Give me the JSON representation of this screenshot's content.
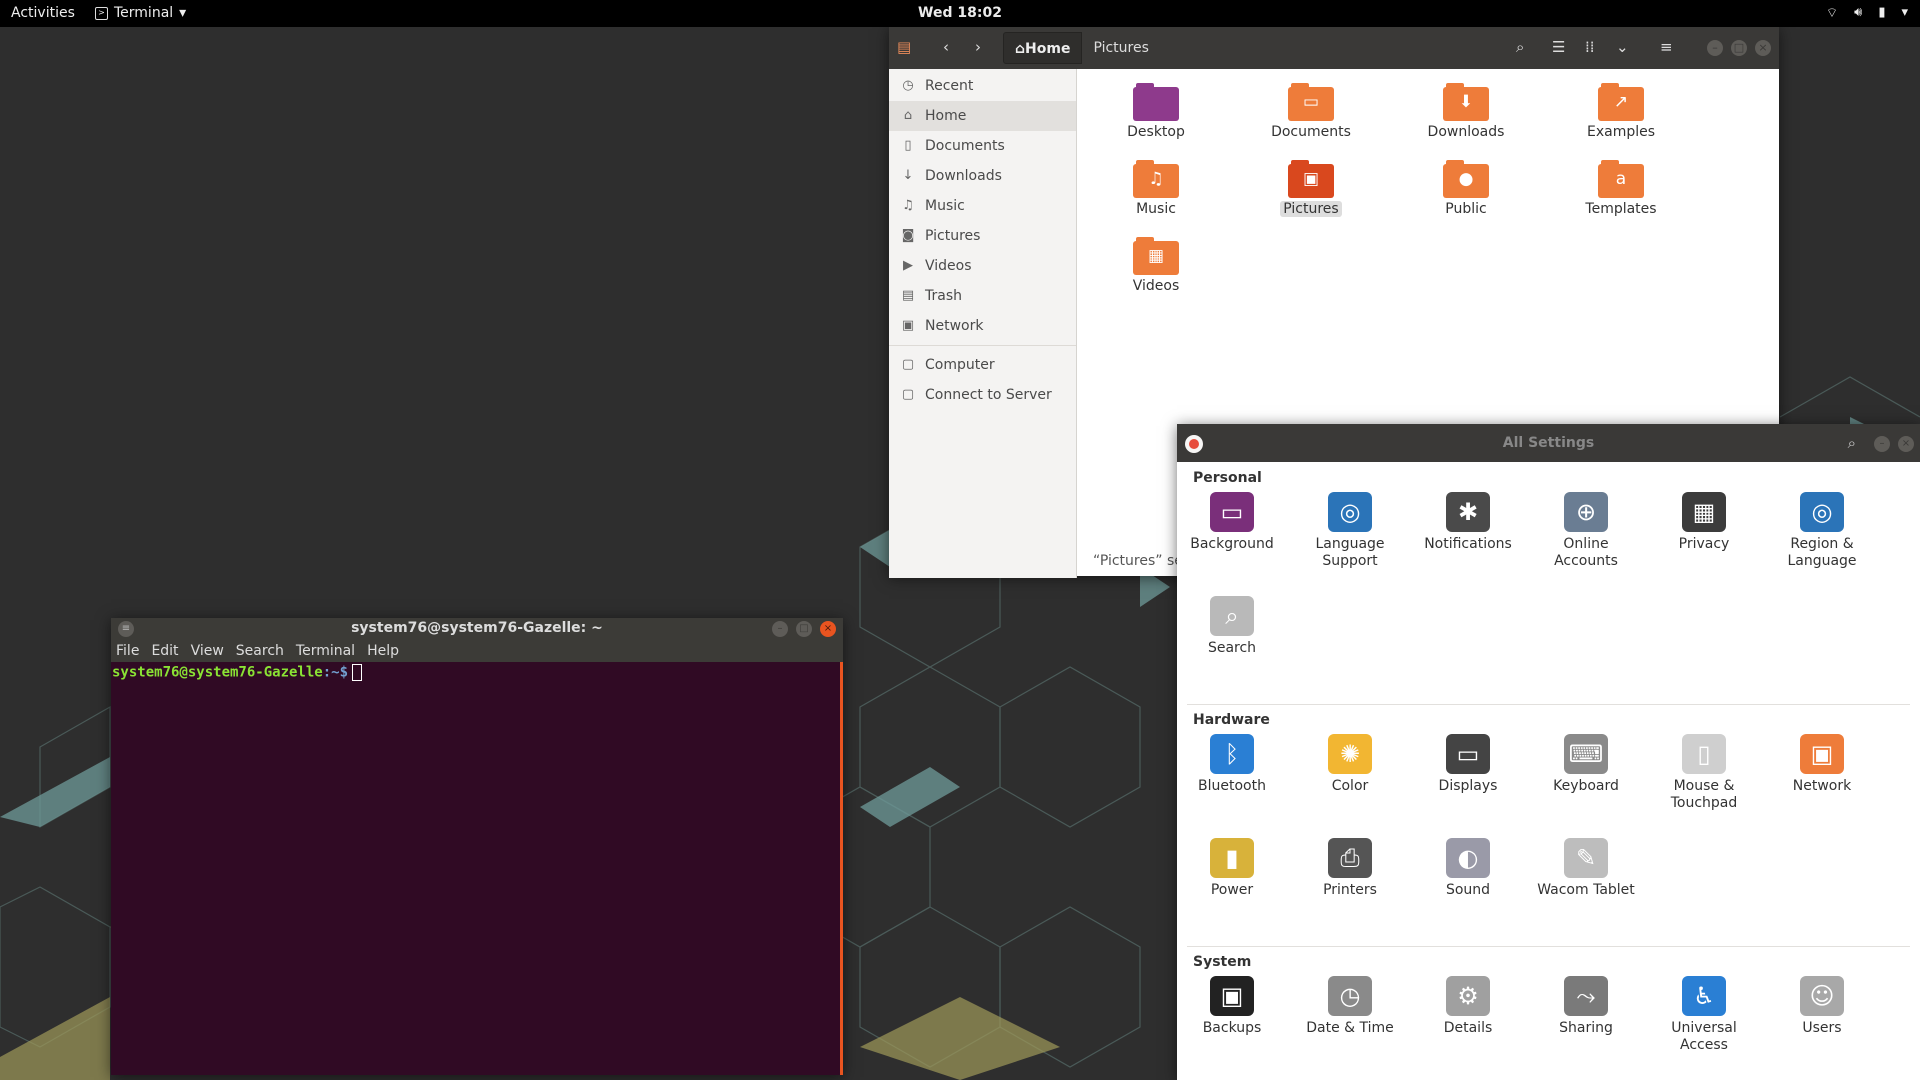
{
  "topbar": {
    "activities": "Activities",
    "app_name": "Terminal",
    "clock": "Wed 18:02"
  },
  "files": {
    "path": [
      "Home",
      "Pictures"
    ],
    "sidebar": [
      {
        "label": "Recent",
        "icon": "clock-icon",
        "glyph": "◷"
      },
      {
        "label": "Home",
        "icon": "home-icon",
        "glyph": "⌂",
        "active": true
      },
      {
        "label": "Documents",
        "icon": "document-icon",
        "glyph": "▯"
      },
      {
        "label": "Downloads",
        "icon": "download-icon",
        "glyph": "↓"
      },
      {
        "label": "Music",
        "icon": "music-icon",
        "glyph": "♫"
      },
      {
        "label": "Pictures",
        "icon": "camera-icon",
        "glyph": "◙"
      },
      {
        "label": "Videos",
        "icon": "video-icon",
        "glyph": "▶"
      },
      {
        "label": "Trash",
        "icon": "trash-icon",
        "glyph": "▤"
      },
      {
        "label": "Network",
        "icon": "network-icon",
        "glyph": "▣"
      },
      {
        "label": "Computer",
        "icon": "computer-icon",
        "glyph": "▢",
        "sep_before": true
      },
      {
        "label": "Connect to Server",
        "icon": "server-icon",
        "glyph": "▢"
      }
    ],
    "items": [
      {
        "label": "Desktop",
        "icon": "desktop-folder-icon",
        "color": "#8e3a8c",
        "emblem": ""
      },
      {
        "label": "Documents",
        "icon": "documents-folder-icon",
        "color": "#ee7c3a",
        "emblem": "▭"
      },
      {
        "label": "Downloads",
        "icon": "downloads-folder-icon",
        "color": "#ee7c3a",
        "emblem": "⬇"
      },
      {
        "label": "Examples",
        "icon": "examples-folder-icon",
        "color": "#ee7c3a",
        "emblem": "↗"
      },
      {
        "label": "Music",
        "icon": "music-folder-icon",
        "color": "#ee7c3a",
        "emblem": "♫"
      },
      {
        "label": "Pictures",
        "icon": "pictures-folder-icon",
        "color": "#d9481e",
        "emblem": "▣",
        "selected": true
      },
      {
        "label": "Public",
        "icon": "public-folder-icon",
        "color": "#ee7c3a",
        "emblem": "●"
      },
      {
        "label": "Templates",
        "icon": "templates-folder-icon",
        "color": "#ee7c3a",
        "emblem": "a"
      },
      {
        "label": "Videos",
        "icon": "videos-folder-icon",
        "color": "#ee7c3a",
        "emblem": "▦"
      }
    ],
    "status": "“Pictures” se"
  },
  "terminal": {
    "title": "system76@system76-Gazelle: ~",
    "menu": [
      "File",
      "Edit",
      "View",
      "Search",
      "Terminal",
      "Help"
    ],
    "prompt_user": "system76@system76-Gazelle",
    "prompt_path": ":~$"
  },
  "settings": {
    "title": "All Settings",
    "sections": [
      {
        "title": "Personal",
        "items": [
          {
            "label": "Background",
            "icon": "background-icon",
            "color": "#7a2f7a",
            "glyph": "▭"
          },
          {
            "label": "Language\nSupport",
            "icon": "language-support-icon",
            "color": "#2b74b8",
            "glyph": "◎"
          },
          {
            "label": "Notifications",
            "icon": "notifications-icon",
            "color": "#4a4a4a",
            "glyph": "✱"
          },
          {
            "label": "Online\nAccounts",
            "icon": "online-accounts-icon",
            "color": "#6a7d93",
            "glyph": "⊕"
          },
          {
            "label": "Privacy",
            "icon": "privacy-icon",
            "color": "#3c3c3c",
            "glyph": "▦"
          },
          {
            "label": "Region &\nLanguage",
            "icon": "region-language-icon",
            "color": "#2b74b8",
            "glyph": "◎"
          },
          {
            "label": "Search",
            "icon": "search-settings-icon",
            "color": "#b9b9b9",
            "glyph": "⌕"
          }
        ]
      },
      {
        "title": "Hardware",
        "items": [
          {
            "label": "Bluetooth",
            "icon": "bluetooth-icon",
            "color": "#2a7fd4",
            "glyph": "ᛒ"
          },
          {
            "label": "Color",
            "icon": "color-icon",
            "color": "#f2b632",
            "glyph": "✺"
          },
          {
            "label": "Displays",
            "icon": "displays-icon",
            "color": "#444",
            "glyph": "▭"
          },
          {
            "label": "Keyboard",
            "icon": "keyboard-icon",
            "color": "#8a8a8a",
            "glyph": "⌨"
          },
          {
            "label": "Mouse &\nTouchpad",
            "icon": "mouse-icon",
            "color": "#cfcfcf",
            "glyph": "▯"
          },
          {
            "label": "Network",
            "icon": "network-settings-icon",
            "color": "#ee7c3a",
            "glyph": "▣"
          },
          {
            "label": "Power",
            "icon": "power-icon",
            "color": "#d8b23a",
            "glyph": "▮"
          },
          {
            "label": "Printers",
            "icon": "printers-icon",
            "color": "#555",
            "glyph": "⎙"
          },
          {
            "label": "Sound",
            "icon": "sound-icon",
            "color": "#9a9aa8",
            "glyph": "◐"
          },
          {
            "label": "Wacom Tablet",
            "icon": "wacom-tablet-icon",
            "color": "#bdbdbd",
            "glyph": "✎"
          }
        ]
      },
      {
        "title": "System",
        "items": [
          {
            "label": "Backups",
            "icon": "backups-icon",
            "color": "#222",
            "glyph": "▣"
          },
          {
            "label": "Date & Time",
            "icon": "date-time-icon",
            "color": "#8a8a8a",
            "glyph": "◷"
          },
          {
            "label": "Details",
            "icon": "details-icon",
            "color": "#a0a0a0",
            "glyph": "⚙"
          },
          {
            "label": "Sharing",
            "icon": "sharing-icon",
            "color": "#7a7a7a",
            "glyph": "⤳"
          },
          {
            "label": "Universal\nAccess",
            "icon": "universal-access-icon",
            "color": "#2a7fd4",
            "glyph": "♿"
          },
          {
            "label": "Users",
            "icon": "users-icon",
            "color": "#a8a8a8",
            "glyph": "☺"
          }
        ]
      }
    ]
  }
}
